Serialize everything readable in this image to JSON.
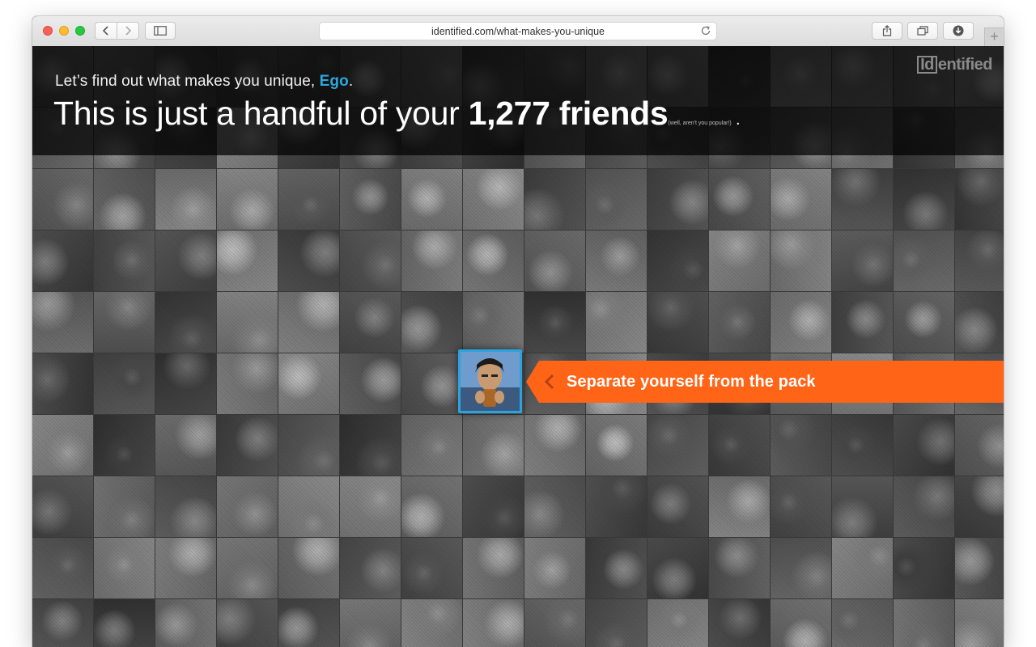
{
  "browser": {
    "url": "identified.com/what-makes-you-unique",
    "icons": {
      "back": "chevron-left-icon",
      "forward": "chevron-right-icon",
      "sidebar": "sidebar-icon",
      "reload": "reload-icon",
      "share": "share-icon",
      "tabs": "tabs-overview-icon",
      "downloads": "download-icon",
      "new_tab": "plus-icon"
    },
    "new_tab_glyph": "+"
  },
  "page": {
    "logo": {
      "prefix": "Id",
      "rest": "entified"
    },
    "intro": {
      "before": "Let’s find out what makes you unique, ",
      "name": "Ego",
      "after": "."
    },
    "headline": {
      "before": "This is just a handful of your ",
      "count": "1,277 friends",
      "aside": "(well, aren't you popular!)",
      "end": " ."
    },
    "callout": {
      "label": "Separate yourself from the pack",
      "color": "#ff6417"
    },
    "accent_color": "#29a9e0"
  }
}
